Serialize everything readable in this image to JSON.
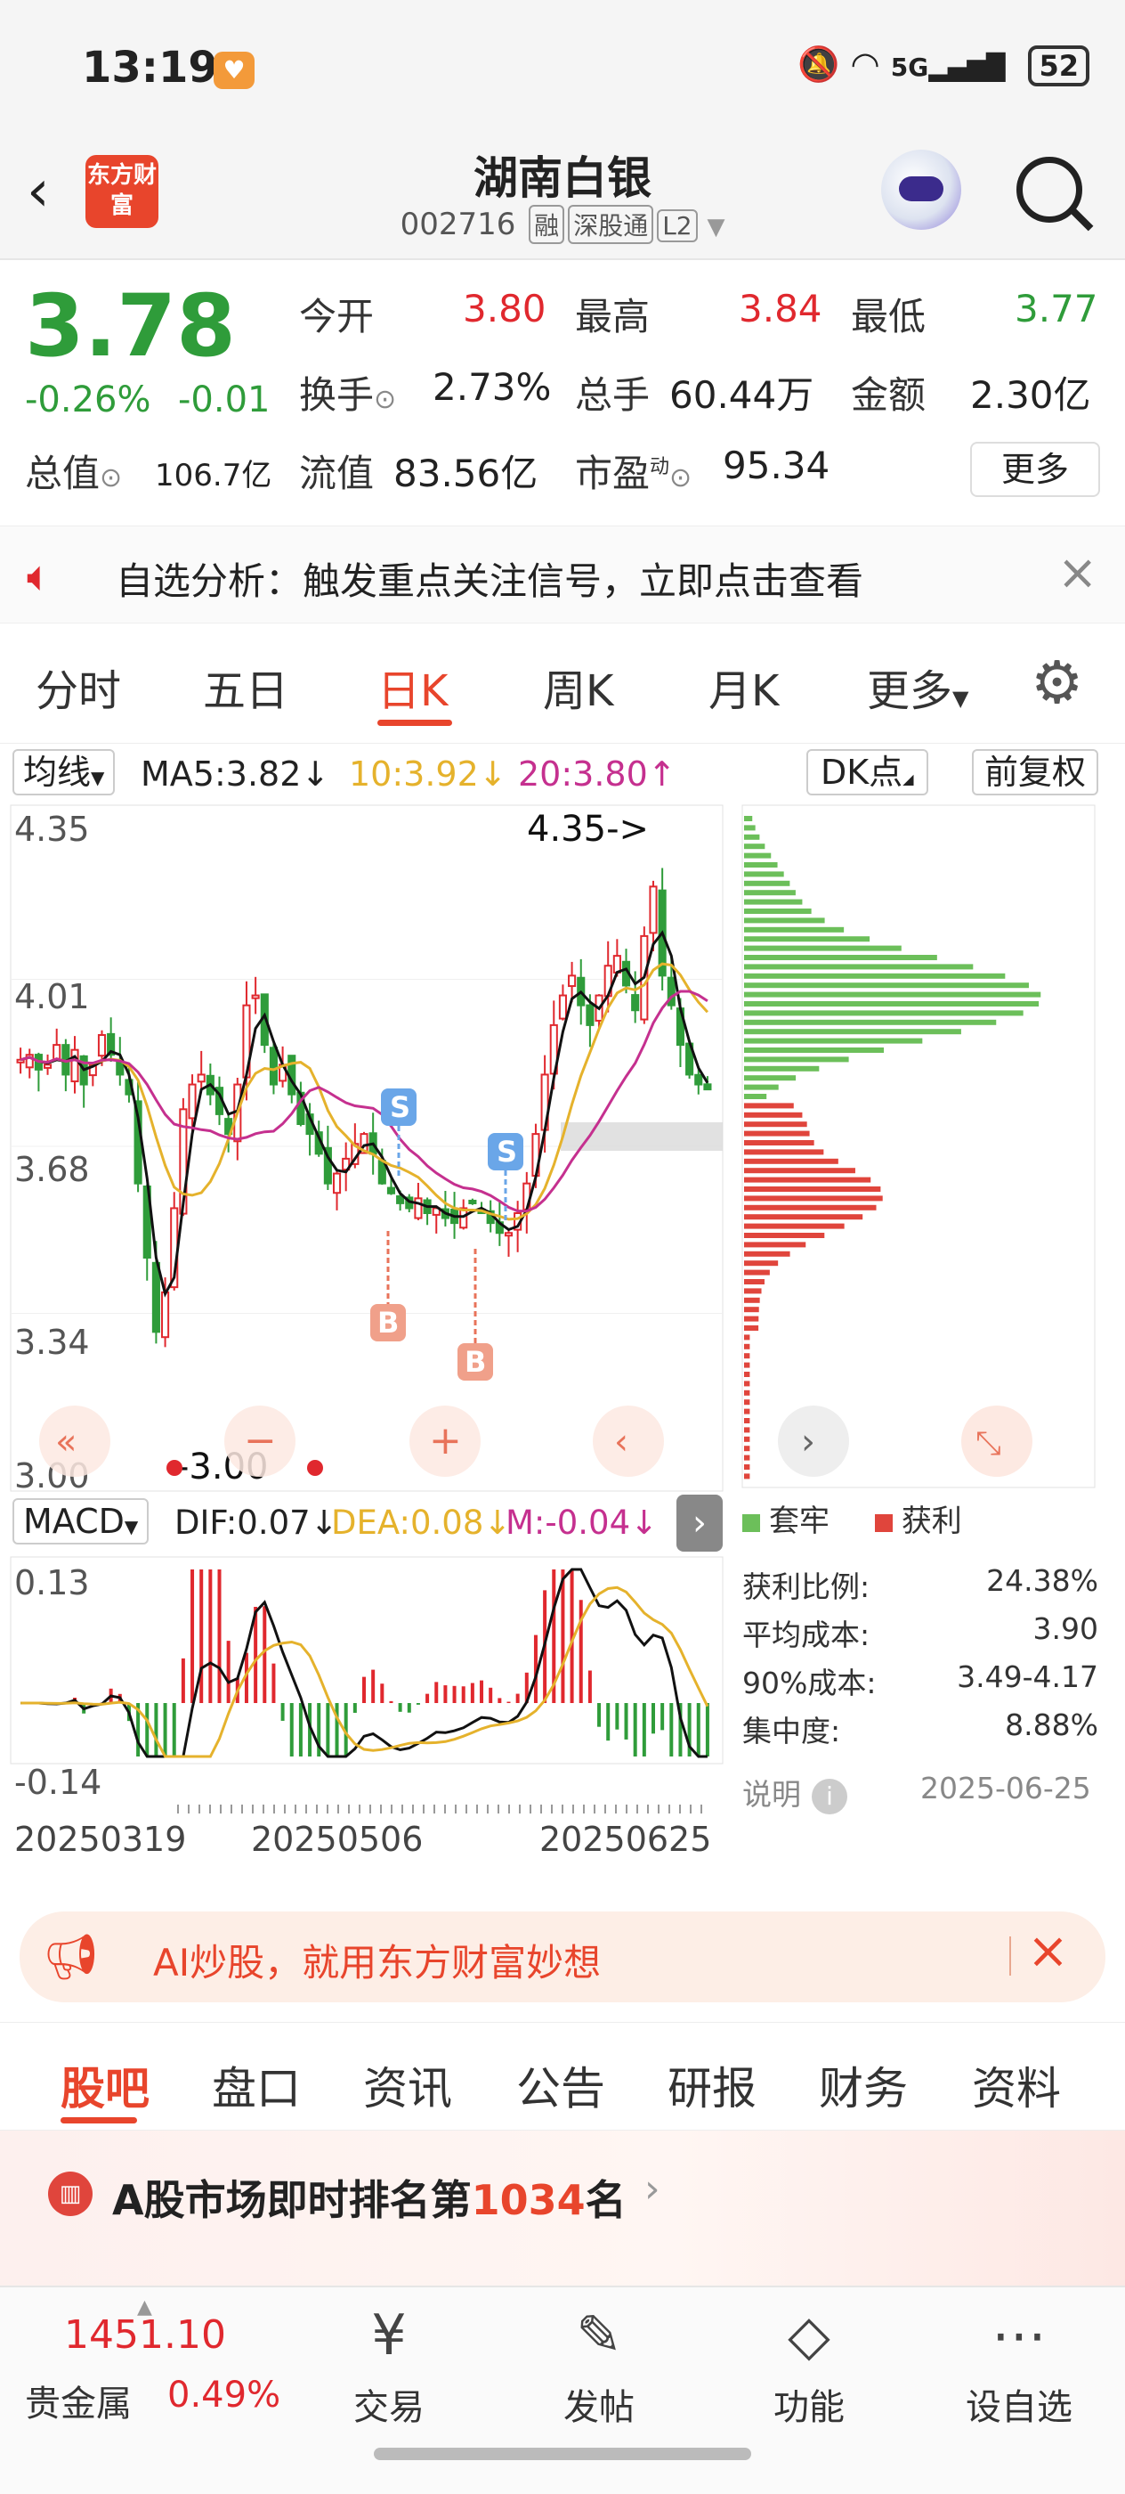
{
  "status_bar": {
    "time": "13:19",
    "network": "5G",
    "battery": "52"
  },
  "header": {
    "logo_text": "东方财富",
    "name": "湖南白银",
    "code": "002716",
    "tags": [
      "融",
      "深股通",
      "L2"
    ]
  },
  "quote": {
    "price": "3.78",
    "change_pct": "-0.26%",
    "change": "-0.01",
    "open_label": "今开",
    "open": "3.80",
    "high_label": "最高",
    "high": "3.84",
    "low_label": "最低",
    "low": "3.77",
    "turnover_label": "换手",
    "turnover": "2.73%",
    "volume_label": "总手",
    "volume": "60.44万",
    "amount_label": "金额",
    "amount": "2.30亿",
    "mktcap_label": "总值",
    "mktcap": "106.7亿",
    "float_label": "流值",
    "float": "83.56亿",
    "pe_label": "市盈",
    "pe_sup": "动",
    "pe": "95.34",
    "more": "更多"
  },
  "notice": {
    "text": "自选分析：触发重点关注信号，立即点击查看"
  },
  "period_tabs": [
    "分时",
    "五日",
    "日K",
    "周K",
    "月K",
    "更多"
  ],
  "chart_bar": {
    "ma_select": "均线",
    "ma5": "MA5:3.82↓",
    "ma10": "10:3.92↓",
    "ma20": "20:3.80↑",
    "dk": "DK点",
    "adjust": "前复权"
  },
  "chart_data": {
    "type": "candlestick",
    "ylim": [
      3.0,
      4.35
    ],
    "y_ticks": [
      "4.35",
      "4.01",
      "3.68",
      "3.34",
      "3.00"
    ],
    "max_label": "4.35->",
    "min_label": "-3.00",
    "signals": [
      "S",
      "S",
      "B",
      "B"
    ],
    "x_ticks": [
      "20250319",
      "20250506",
      "20250625"
    ],
    "macd": {
      "select": "MACD",
      "dif": "DIF:0.07↓",
      "dea": "DEA:0.08↓",
      "m": "M:-0.04↓",
      "y_ticks": [
        "0.13",
        "-0.14"
      ]
    }
  },
  "chip": {
    "legend_trapped": "套牢",
    "legend_profit": "获利",
    "rows": [
      {
        "label": "获利比例:",
        "value": "24.38%"
      },
      {
        "label": "平均成本:",
        "value": "3.90"
      },
      {
        "label": "90%成本:",
        "value": "3.49-4.17"
      },
      {
        "label": "集中度:",
        "value": "8.88%"
      }
    ],
    "note": "说明",
    "date": "2025-06-25"
  },
  "ai_banner": {
    "text": "AI炒股，就用东方财富妙想"
  },
  "bottom_tabs": [
    "股吧",
    "盘口",
    "资讯",
    "公告",
    "研报",
    "财务",
    "资料"
  ],
  "ranking": {
    "prefix": "A股市场即时排名第",
    "number": "1034",
    "suffix": "名"
  },
  "bottom_nav": {
    "index_value": "1451.10",
    "index_name": "贵金属",
    "index_pct": "0.49%",
    "items": [
      "交易",
      "发帖",
      "功能",
      "设自选"
    ]
  },
  "colors": {
    "up": "#e0282e",
    "down": "#2f9c3a",
    "ma10": "#e5b22c",
    "ma20": "#c5308f",
    "accent": "#e8452c"
  }
}
